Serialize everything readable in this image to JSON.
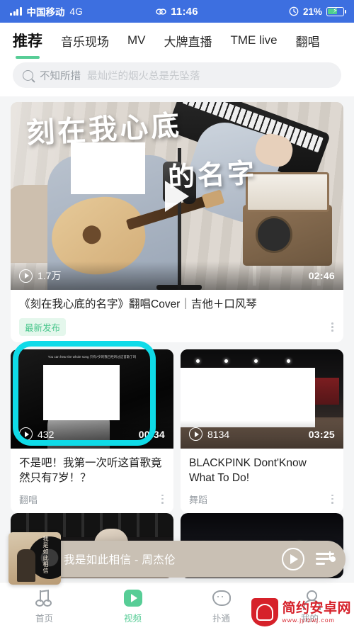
{
  "status_bar": {
    "carrier": "中国移动",
    "network": "4G",
    "time": "11:46",
    "battery_percent": "21%",
    "signal_icon": "signal-bars-icon",
    "link_icon": "link-icon",
    "alarm_icon": "alarm-icon",
    "battery_icon": "battery-charging-icon",
    "bolt_glyph": "⚡",
    "bg_color": "#3d6fe0"
  },
  "tabs": {
    "items": [
      {
        "label": "推荐",
        "active": true
      },
      {
        "label": "音乐现场",
        "active": false
      },
      {
        "label": "MV",
        "active": false
      },
      {
        "label": "大牌直播",
        "active": false
      },
      {
        "label": "TME live",
        "active": false
      },
      {
        "label": "翻唱",
        "active": false
      }
    ],
    "accent_color": "#57cd96"
  },
  "search": {
    "icon": "search-icon",
    "keyword": "不知所措",
    "suggestion": "最灿烂的烟火总是先坠落"
  },
  "feed": {
    "hero": {
      "title": "《刻在我心底的名字》翻唱Cover｜吉他＋口风琴",
      "badge": "最新发布",
      "plays": "1.7万",
      "duration": "02:46",
      "overlay_text_line1": "刻在我心底",
      "overlay_text_line2": "的名字",
      "play_icon": "play-circle-icon",
      "big_play_icon": "play-triangle-icon",
      "more_icon": "more-vertical-icon"
    },
    "grid": [
      {
        "title": "不是吧！我第一次听这首歌竟然只有7岁！？",
        "category": "翻唱",
        "plays": "432",
        "duration": "00:34",
        "overlay_small_text": "You can hear the whole song 只有7岁的我已经听过这首歌了吗",
        "play_icon": "play-circle-icon",
        "more_icon": "more-vertical-icon",
        "highlighted": true
      },
      {
        "title": "BLACKPINK Dont'Know What To Do!",
        "category": "舞蹈",
        "plays": "8134",
        "duration": "03:25",
        "play_icon": "play-circle-icon",
        "more_icon": "more-vertical-icon",
        "highlighted": false
      }
    ]
  },
  "annotation": {
    "type": "highlight-rectangle",
    "color": "#0fdbe8",
    "target": "grid-card-1"
  },
  "mini_player": {
    "track": "我是如此相信 - 周杰伦",
    "album_art_text": "我是如此相信",
    "play_icon": "play-circle-icon",
    "playlist_icon": "playlist-music-icon",
    "bg_color": "#c9c0b4"
  },
  "bottom_nav": {
    "items": [
      {
        "label": "首页",
        "icon": "music-note-icon",
        "active": false
      },
      {
        "label": "视频",
        "icon": "video-play-icon",
        "active": true
      },
      {
        "label": "扑通",
        "icon": "chat-bubble-icon",
        "active": false
      },
      {
        "label": "我的",
        "icon": "person-icon",
        "active": false
      }
    ],
    "active_color": "#57cd96"
  },
  "watermark": {
    "name": "简约安卓网",
    "url": "www.jylzwj.com",
    "color": "#d6212a",
    "icon": "android-shield-icon"
  }
}
